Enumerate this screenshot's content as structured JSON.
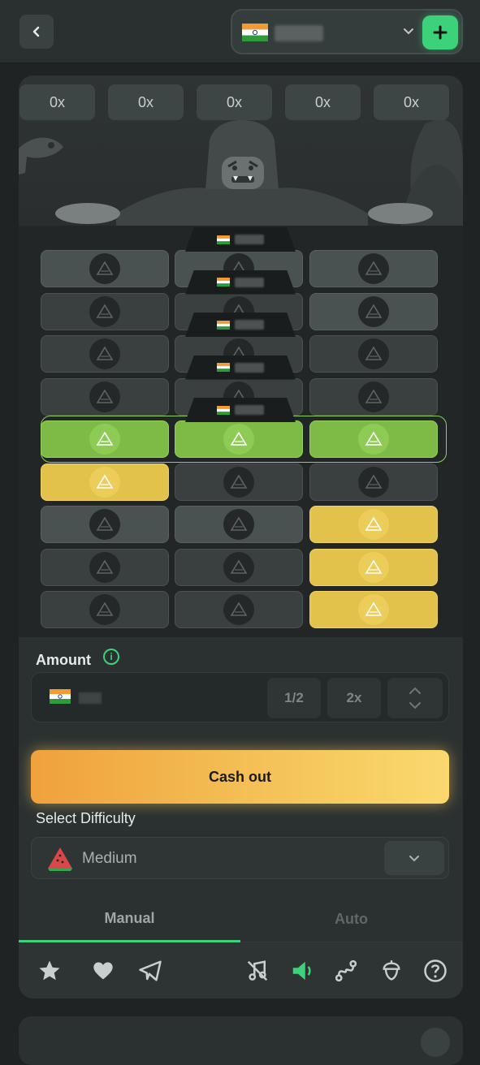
{
  "topbar": {
    "back_icon": "chevron-left-icon",
    "wallet": {
      "flag": "india-flag-icon",
      "dropdown_icon": "chevron-down-icon",
      "deposit_icon": "plus-icon"
    }
  },
  "game": {
    "multipliers": [
      "0x",
      "0x",
      "0x",
      "0x",
      "0x"
    ],
    "rows": [
      [
        "default",
        "default",
        "default"
      ],
      [
        "dim",
        "dim",
        "default"
      ],
      [
        "dim",
        "dim",
        "dim"
      ],
      [
        "dim",
        "dim",
        "dim"
      ],
      [
        "green",
        "green",
        "green"
      ],
      [
        "gold",
        "dim",
        "dim"
      ],
      [
        "default",
        "default",
        "gold"
      ],
      [
        "dim",
        "dim",
        "gold"
      ],
      [
        "dim",
        "dim",
        "gold"
      ]
    ]
  },
  "controls": {
    "amount_label": "Amount",
    "info_glyph": "i",
    "half_label": "1/2",
    "double_label": "2x",
    "cashout_label": "Cash out",
    "difficulty_label": "Select Difficulty",
    "difficulty_value": "Medium",
    "tabs": [
      {
        "label": "Manual",
        "active": true
      },
      {
        "label": "Auto",
        "active": false
      }
    ],
    "toolbar_icons": [
      "star-icon",
      "heart-icon",
      "telegram-icon",
      "music-off-icon",
      "sound-icon",
      "route-icon",
      "acorn-icon",
      "help-icon"
    ]
  },
  "colors": {
    "accent_green": "#3cd27a",
    "tile_green": "#7dbb46",
    "tile_gold": "#e3c24b",
    "cashout_gradient_start": "#f0a13c",
    "cashout_gradient_end": "#fbd96e"
  }
}
